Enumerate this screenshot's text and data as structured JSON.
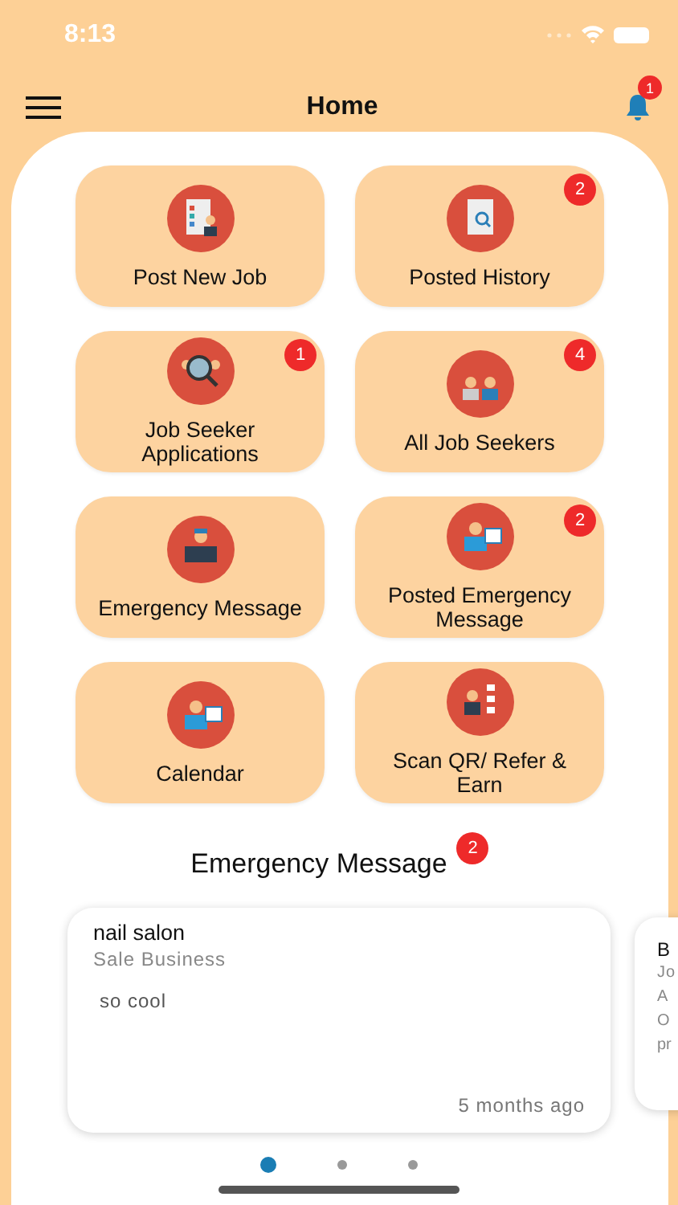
{
  "status_bar": {
    "time": "8:13"
  },
  "header": {
    "title": "Home",
    "notification_count": "1"
  },
  "tiles": [
    {
      "label": "Post New Job",
      "kind": "document"
    },
    {
      "label": "Posted History",
      "kind": "search",
      "badge": "2"
    },
    {
      "label": "Job Seeker Applications",
      "kind": "magnifier",
      "badge": "1"
    },
    {
      "label": "All Job Seekers",
      "kind": "people",
      "badge": "4"
    },
    {
      "label": "Emergency Message",
      "kind": "desk"
    },
    {
      "label": "Posted Emergency Message",
      "kind": "calendar",
      "badge": "2"
    },
    {
      "label": "Calendar",
      "kind": "calendar"
    },
    {
      "label": "Scan QR/ Refer & Earn",
      "kind": "list"
    }
  ],
  "emergency": {
    "title": "Emergency Message",
    "badge": "2",
    "cards": [
      {
        "title": "nail salon",
        "subtitle": "Sale Business",
        "body": "so cool",
        "time": "5 months ago"
      },
      {
        "title": "B",
        "subtitle": "Jo",
        "body_lines": [
          "A",
          "O",
          "pr"
        ]
      }
    ]
  },
  "pager": [
    {
      "selected": true
    },
    {
      "selected": false
    },
    {
      "selected": false
    }
  ]
}
